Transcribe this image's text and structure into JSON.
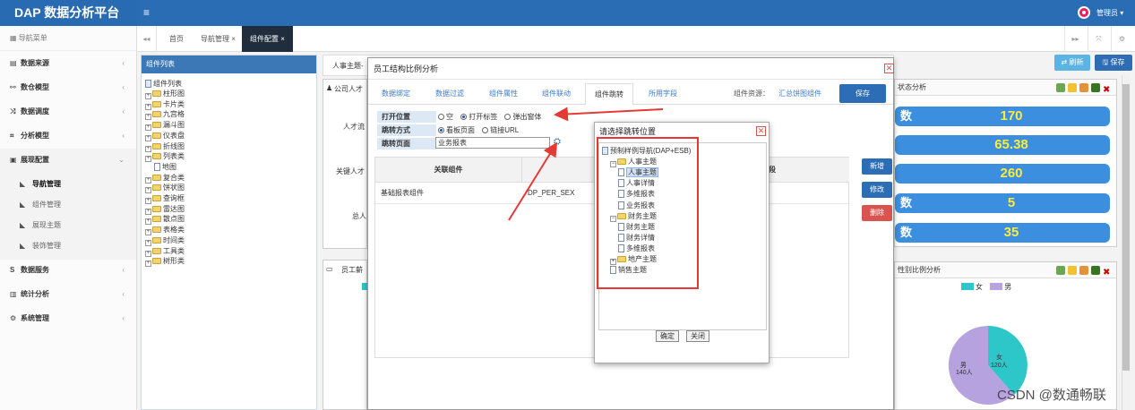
{
  "app": {
    "title": "DAP 数据分析平台",
    "user": "管理员 ▾",
    "menu_toggle": "≡"
  },
  "sidebar": {
    "header": "导航菜单",
    "items": [
      {
        "label": "数据来源",
        "icon": "database-icon",
        "glyph": "▤",
        "arrow": "‹"
      },
      {
        "label": "数仓模型",
        "icon": "share-icon",
        "glyph": "⚯",
        "arrow": "‹"
      },
      {
        "label": "数据调度",
        "icon": "shuffle-icon",
        "glyph": "⤨",
        "arrow": "‹"
      },
      {
        "label": "分析模型",
        "icon": "crop-icon",
        "glyph": "⌗",
        "arrow": "‹"
      },
      {
        "label": "展现配置",
        "icon": "screen-icon",
        "glyph": "▣",
        "arrow": "⌄"
      }
    ],
    "sub_items": [
      {
        "label": "导航管理",
        "active": true
      },
      {
        "label": "组件管理",
        "active": false
      },
      {
        "label": "展现主题",
        "active": false
      },
      {
        "label": "装饰管理",
        "active": false
      }
    ],
    "bottom_items": [
      {
        "label": "数据服务",
        "glyph": "S",
        "arrow": "‹"
      },
      {
        "label": "统计分析",
        "glyph": "▥",
        "arrow": "‹"
      },
      {
        "label": "系统管理",
        "glyph": "⚙",
        "arrow": "‹"
      }
    ]
  },
  "tabs": {
    "prev": "◂◂",
    "home": "首页",
    "nav": "导航管理 ×",
    "active": "组件配置 ×",
    "next": "▸▸",
    "fullscreen": "⤧",
    "settings": "⚙"
  },
  "comp_list": {
    "title": "组件列表",
    "root": "组件列表",
    "items": [
      {
        "label": "柱形图",
        "type": "folder"
      },
      {
        "label": "卡片类",
        "type": "folder"
      },
      {
        "label": "九宫格",
        "type": "folder"
      },
      {
        "label": "漏斗图",
        "type": "folder"
      },
      {
        "label": "仪表盘",
        "type": "folder"
      },
      {
        "label": "折线图",
        "type": "folder"
      },
      {
        "label": "列表类",
        "type": "folder"
      },
      {
        "label": "地图",
        "type": "doc"
      },
      {
        "label": "复合类",
        "type": "folder"
      },
      {
        "label": "饼状图",
        "type": "folder"
      },
      {
        "label": "查询框",
        "type": "folder"
      },
      {
        "label": "雷达图",
        "type": "folder"
      },
      {
        "label": "散点图",
        "type": "folder"
      },
      {
        "label": "表格类",
        "type": "folder"
      },
      {
        "label": "时间类",
        "type": "folder"
      },
      {
        "label": "工具类",
        "type": "folder"
      },
      {
        "label": "树形类",
        "type": "folder"
      }
    ]
  },
  "middle": {
    "tab1": "人事主题-",
    "panel1_title": "公司人才",
    "row1": "人才流",
    "row2": "关键人才",
    "row3": "总人",
    "panel2_title": "员工薪"
  },
  "right": {
    "refresh": "⇄ 刷新",
    "save": "🖫 保存",
    "panel1_title": "状态分析",
    "stats": [
      {
        "label": "数",
        "value": "170"
      },
      {
        "label": "",
        "value": "65.38"
      },
      {
        "label": "",
        "value": "260"
      },
      {
        "label": "数",
        "value": "5"
      },
      {
        "label": "数",
        "value": "35"
      }
    ],
    "panel2_title": "性别比例分析",
    "legend": [
      {
        "name": "女",
        "color": "#2ec7c9"
      },
      {
        "name": "男",
        "color": "#b6a2de"
      }
    ],
    "pie": {
      "male_label": "男",
      "male_count": "140人",
      "female_label": "女",
      "female_count": "120人"
    }
  },
  "modal": {
    "title": "员工结构比例分析",
    "close": "✕",
    "tabs": [
      "数据绑定",
      "数据过滤",
      "组件属性",
      "组件联动",
      "组件跳转",
      "所用字段"
    ],
    "active_tab": "组件跳转",
    "resource_label": "组件资源：",
    "resource_value": "汇总饼图组件",
    "save": "保存",
    "open_pos_label": "打开位置",
    "open_pos_opts": [
      "空",
      "打开标签",
      "弹出窗体"
    ],
    "jump_mode_label": "跳转方式",
    "jump_mode_opts": [
      "看板页面",
      "链接URL"
    ],
    "jump_page_label": "跳转页面",
    "jump_page_value": "业务报表",
    "pick_icon": "⛭",
    "table": {
      "col1": "关联组件",
      "col2": "源",
      "col3": "段",
      "rows": [
        {
          "comp": "基础报表组件",
          "field": "DP_PER_SEX"
        }
      ]
    },
    "btn_add": "新增",
    "btn_edit": "修改",
    "btn_del": "删除"
  },
  "subdlg": {
    "title": "请选择跳转位置",
    "close": "✕",
    "tree": [
      {
        "label": "预制样例导航(DAP+ESB)",
        "level": 0,
        "type": "root",
        "pm": ""
      },
      {
        "label": "人事主题",
        "level": 1,
        "type": "folder",
        "pm": "−"
      },
      {
        "label": "人事主题",
        "level": 2,
        "type": "doc",
        "selected": true
      },
      {
        "label": "人事详情",
        "level": 2,
        "type": "doc"
      },
      {
        "label": "多维报表",
        "level": 2,
        "type": "doc"
      },
      {
        "label": "业务报表",
        "level": 2,
        "type": "doc"
      },
      {
        "label": "财务主题",
        "level": 1,
        "type": "folder",
        "pm": "−"
      },
      {
        "label": "财务主题",
        "level": 2,
        "type": "doc"
      },
      {
        "label": "财务详情",
        "level": 2,
        "type": "doc"
      },
      {
        "label": "多维报表",
        "level": 2,
        "type": "doc"
      },
      {
        "label": "地产主题",
        "level": 1,
        "type": "folder",
        "pm": "+"
      },
      {
        "label": "销售主题",
        "level": 1,
        "type": "doc"
      }
    ],
    "ok": "确定",
    "cancel": "关闭"
  },
  "watermark": "CSDN @数通畅联",
  "colors": {
    "topbar": "#2a6db5",
    "primary": "#2d6db5",
    "stat": "#3b8fde",
    "stat_value": "#ffeb3b",
    "highlight": "#e53935"
  }
}
